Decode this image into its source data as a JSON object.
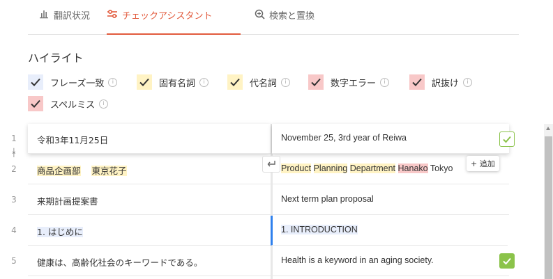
{
  "tabs": [
    {
      "label": "翻訳状況",
      "icon": "bar-chart-icon"
    },
    {
      "label": "チェックアシスタント",
      "icon": "sliders-icon"
    },
    {
      "label": "検索と置換",
      "icon": "search-replace-icon"
    }
  ],
  "highlight": {
    "title": "ハイライト",
    "options": [
      {
        "label": "フレーズ一致",
        "color": "#e8eefb",
        "checked": true
      },
      {
        "label": "固有名詞",
        "color": "#fff3c4",
        "checked": true
      },
      {
        "label": "代名詞",
        "color": "#fff3c4",
        "checked": true
      },
      {
        "label": "数字エラー",
        "color": "#f8c8c8",
        "checked": true
      },
      {
        "label": "訳抜け",
        "color": "#f8c8c8",
        "checked": true
      },
      {
        "label": "スペルミス",
        "color": "#f8c8c8",
        "checked": true
      }
    ],
    "info_glyph": "i"
  },
  "rows": [
    {
      "num": "1",
      "source": "令和3年11月25日",
      "target": "November 25, 3rd year of Reiwa"
    },
    {
      "num": "2",
      "source_parts": [
        "商品企画部",
        "東京花子"
      ],
      "target_parts": [
        "Product",
        "Planning",
        "Department",
        "Hanako",
        "Tokyo"
      ]
    },
    {
      "num": "3",
      "source": "来期計画提案書",
      "target": "Next term plan proposal"
    },
    {
      "num": "4",
      "source": "1. はじめに",
      "target": "1. INTRODUCTION"
    },
    {
      "num": "5",
      "source": "健康は、高齢化社会のキーワードである。",
      "target": "Health is a keyword in an aging society."
    }
  ],
  "add_button": {
    "label": "+ 追加"
  },
  "colors": {
    "accent": "#e25a3c",
    "confirm": "#8bc34a",
    "focus_bar": "#2f80ed"
  }
}
